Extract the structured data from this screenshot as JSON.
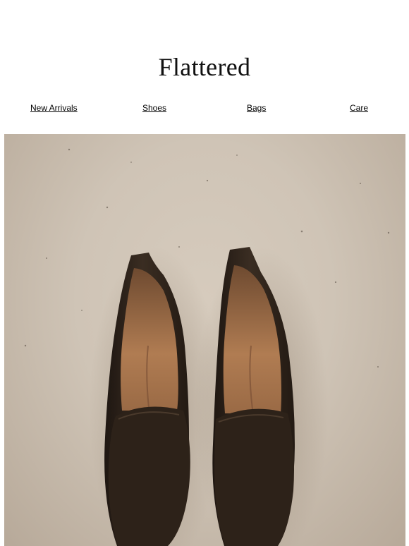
{
  "header": {
    "logo_text": "Flattered"
  },
  "nav": {
    "items": [
      {
        "label": "New Arrivals"
      },
      {
        "label": "Shoes"
      },
      {
        "label": "Bags"
      },
      {
        "label": "Care"
      }
    ]
  },
  "hero": {
    "image": "pair of dark brown leather loafers on concrete floor",
    "colors": {
      "floor": "#cfc4b6",
      "leather": "#2b2119",
      "lining": "#a8764f"
    }
  }
}
